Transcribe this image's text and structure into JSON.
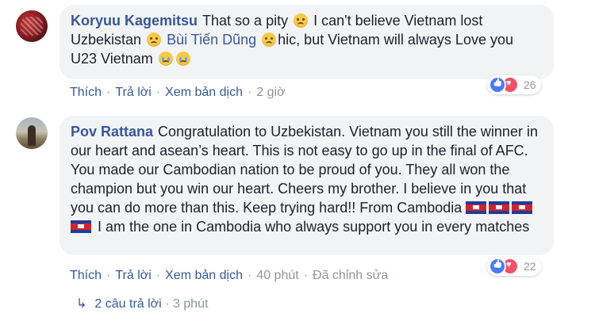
{
  "comments": [
    {
      "author": "Koryuu Kagemitsu",
      "text_parts": [
        "That so a pity",
        "I can't believe Vietnam lost Uzbekistan",
        "hic, but Vietnam will always Love you U23 Vietnam"
      ],
      "mention": "Bùi Tiến Dũng",
      "actions": {
        "like": "Thích",
        "reply": "Trả lời",
        "translate": "Xem bản dịch",
        "time": "2 giờ"
      },
      "reaction_count": "26"
    },
    {
      "author": "Pov Rattana",
      "text_parts": [
        "Congratulation to Uzbekistan. Vietnam you still the winner in our heart and asean’s heart. This is not easy to go up in the final of AFC. You made our Cambodian nation to be proud of you. They all won the champion but you win our heart. Cheers my brother. I believe in you that you can do more than this. Keep trying hard!! From Cambodia",
        "I am the one in Cambodia who always support you in every matches"
      ],
      "actions": {
        "like": "Thích",
        "reply": "Trả lời",
        "translate": "Xem bản dịch",
        "time": "40 phút",
        "edited": "Đã chỉnh sửa"
      },
      "reaction_count": "22"
    }
  ],
  "replies": {
    "label": "2 câu trả lời",
    "time": "3 phút"
  },
  "icons": [
    "confused-face-emoji",
    "crying-face-emoji",
    "cambodia-flag-emoji",
    "like-reaction-icon",
    "love-reaction-icon",
    "reply-arrow-icon"
  ],
  "colors": {
    "link": "#385898",
    "muted": "#90949c",
    "bubble": "#f2f3f5",
    "like": "#4a7aff",
    "love": "#f25268"
  }
}
